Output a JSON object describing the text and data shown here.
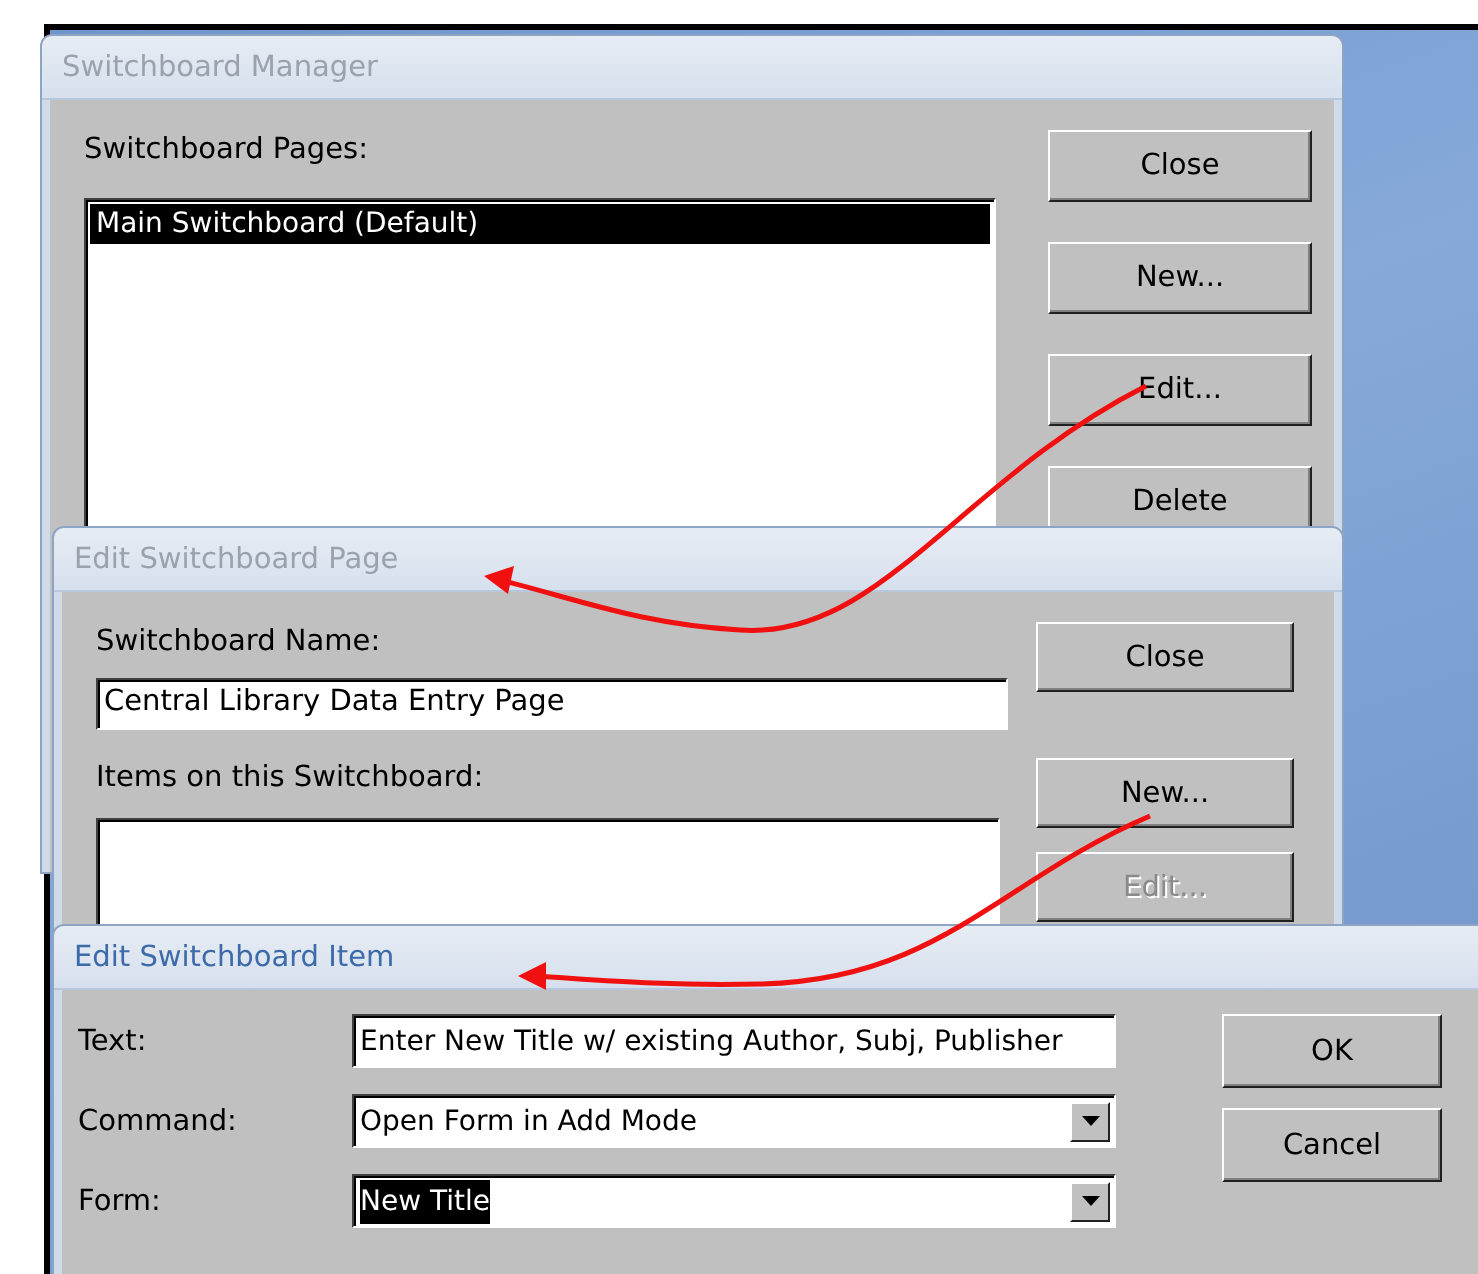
{
  "switchboard_manager": {
    "title": "Switchboard Manager",
    "active": false,
    "list_label": "Switchboard Pages:",
    "pages": [
      {
        "text": "Main Switchboard (Default)",
        "selected": true
      }
    ],
    "buttons": [
      {
        "label": "Close",
        "disabled": false
      },
      {
        "label": "New...",
        "disabled": false
      },
      {
        "label": "Edit...",
        "disabled": false
      },
      {
        "label": "Delete",
        "disabled": false
      }
    ]
  },
  "edit_switchboard_page": {
    "title": "Edit Switchboard Page",
    "active": false,
    "name_label": "Switchboard Name:",
    "name_value": "Central Library Data Entry Page",
    "items_label": "Items on this Switchboard:",
    "buttons": [
      {
        "label": "Close",
        "disabled": false
      },
      {
        "label": "New...",
        "disabled": false
      },
      {
        "label": "Edit...",
        "disabled": true
      }
    ]
  },
  "edit_switchboard_item": {
    "title": "Edit Switchboard Item",
    "active": true,
    "fields": [
      {
        "label": "Text:",
        "kind": "text",
        "value": "Enter New Title w/ existing Author, Subj, Publisher",
        "selected": false
      },
      {
        "label": "Command:",
        "kind": "combo",
        "value": "Open Form in Add Mode",
        "selected": false
      },
      {
        "label": "Form:",
        "kind": "combo",
        "value": "New Title",
        "selected": true
      }
    ],
    "buttons": [
      {
        "label": "OK",
        "disabled": false
      },
      {
        "label": "Cancel",
        "disabled": false
      }
    ]
  }
}
